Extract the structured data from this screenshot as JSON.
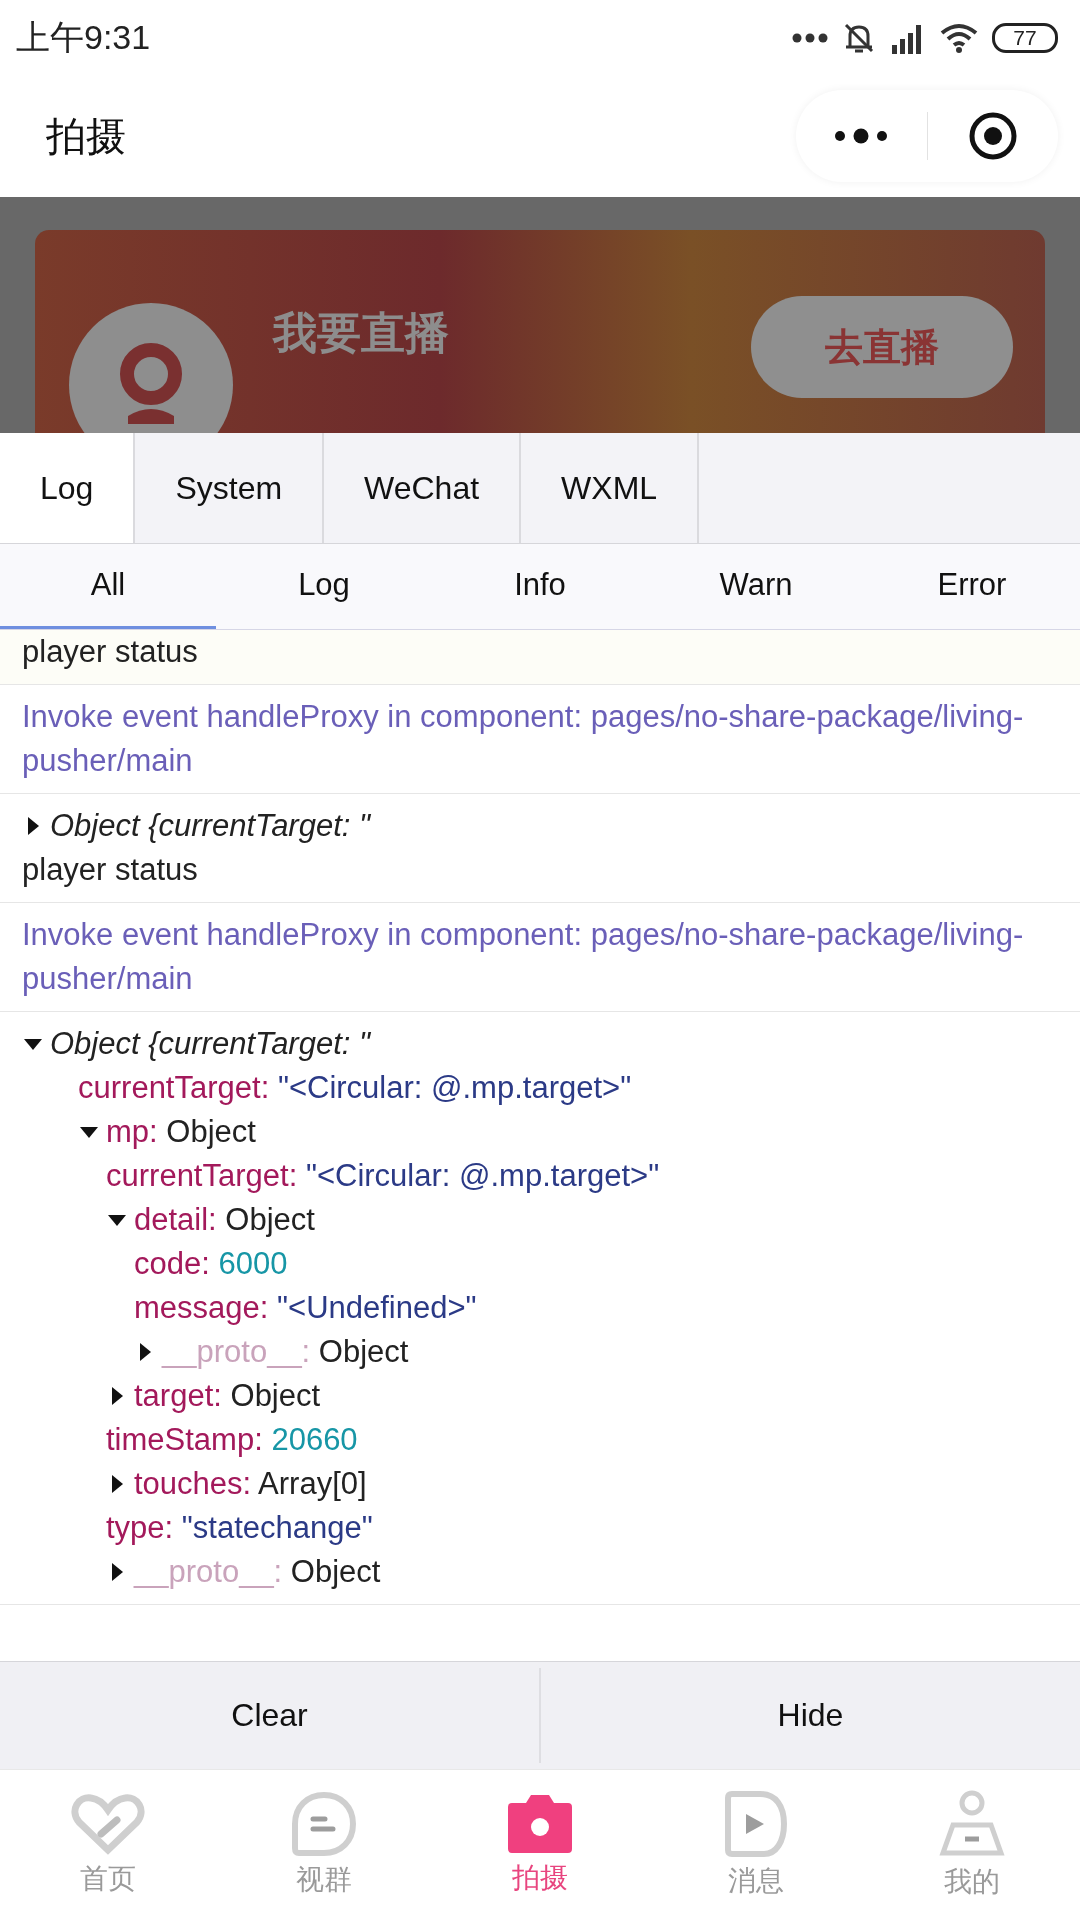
{
  "status_bar": {
    "time": "上午9:31",
    "battery": "77"
  },
  "header": {
    "title": "拍摄"
  },
  "banner": {
    "title": "我要直播",
    "button": "去直播"
  },
  "console": {
    "tabs": [
      {
        "label": "Log",
        "selected": true
      },
      {
        "label": "System",
        "selected": false
      },
      {
        "label": "WeChat",
        "selected": false
      },
      {
        "label": "WXML",
        "selected": false
      }
    ],
    "filters": [
      {
        "label": "All",
        "selected": true
      },
      {
        "label": "Log",
        "selected": false
      },
      {
        "label": "Info",
        "selected": false
      },
      {
        "label": "Warn",
        "selected": false
      },
      {
        "label": "Error",
        "selected": false
      }
    ],
    "entries": [
      {
        "kind": "text",
        "text": "player status"
      },
      {
        "kind": "info",
        "text": "Invoke event handleProxy in component: pages/no-share-package/living-pusher/main"
      },
      {
        "kind": "object",
        "summary": "Object {currentTarget: \"",
        "expanded": false,
        "text": "player status"
      },
      {
        "kind": "info",
        "text": "Invoke event handleProxy in component: pages/no-share-package/living-pusher/main"
      },
      {
        "kind": "object",
        "summary": "Object {currentTarget: \"",
        "expanded": true,
        "children": [
          {
            "key": "currentTarget:",
            "kind": "string",
            "value": "\"<Circular: @.mp.target>\""
          },
          {
            "key": "mp:",
            "kind": "object",
            "value": "Object",
            "expanded": true,
            "children": [
              {
                "key": "currentTarget:",
                "kind": "string",
                "value": "\"<Circular: @.mp.target>\""
              },
              {
                "key": "detail:",
                "kind": "object",
                "value": "Object",
                "expanded": true,
                "children": [
                  {
                    "key": "code:",
                    "kind": "number",
                    "value": "6000"
                  },
                  {
                    "key": "message:",
                    "kind": "string",
                    "value": "\"<Undefined>\""
                  },
                  {
                    "key": "__proto__:",
                    "kind": "proto",
                    "value": "Object",
                    "expanded": false
                  }
                ]
              },
              {
                "key": "target:",
                "kind": "object",
                "value": "Object",
                "expanded": false
              },
              {
                "key": "timeStamp:",
                "kind": "number",
                "value": "20660"
              },
              {
                "key": "touches:",
                "kind": "object",
                "value": "Array[0]",
                "expanded": false
              },
              {
                "key": "type:",
                "kind": "string",
                "value": "\"statechange\""
              },
              {
                "key": "__proto__:",
                "kind": "proto",
                "value": "Object",
                "expanded": false
              }
            ]
          }
        ]
      }
    ],
    "buttons": [
      "Clear",
      "Hide"
    ]
  },
  "tab_bar": [
    {
      "label": "首页",
      "kind": "heart",
      "selected": false
    },
    {
      "label": "视群",
      "kind": "chat",
      "selected": false
    },
    {
      "label": "拍摄",
      "kind": "camera",
      "selected": true
    },
    {
      "label": "消息",
      "kind": "play",
      "selected": false
    },
    {
      "label": "我的",
      "kind": "person",
      "selected": false
    }
  ]
}
